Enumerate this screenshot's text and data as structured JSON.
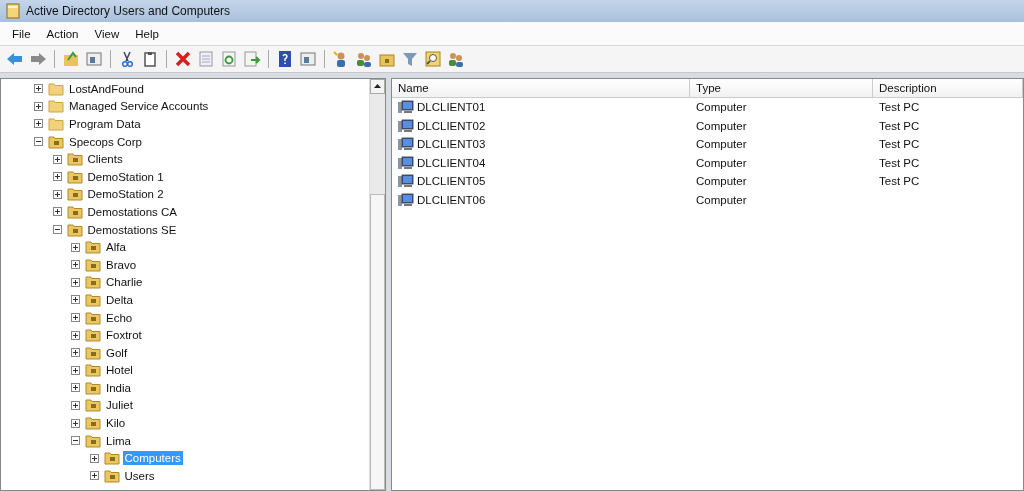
{
  "window": {
    "title": "Active Directory Users and Computers"
  },
  "menu": [
    "File",
    "Action",
    "View",
    "Help"
  ],
  "tree": [
    {
      "label": "LostAndFound",
      "kind": "container",
      "expanded": false,
      "selected": false
    },
    {
      "label": "Managed Service Accounts",
      "kind": "container",
      "expanded": false,
      "selected": false
    },
    {
      "label": "Program Data",
      "kind": "container",
      "expanded": false,
      "selected": false
    },
    {
      "label": "Specops Corp",
      "kind": "ou",
      "expanded": true,
      "selected": false,
      "children": [
        {
          "label": "Clients",
          "kind": "ou",
          "expanded": false,
          "selected": false
        },
        {
          "label": "DemoStation 1",
          "kind": "ou",
          "expanded": false,
          "selected": false
        },
        {
          "label": "DemoStation 2",
          "kind": "ou",
          "expanded": false,
          "selected": false
        },
        {
          "label": "Demostations CA",
          "kind": "ou",
          "expanded": false,
          "selected": false
        },
        {
          "label": "Demostations SE",
          "kind": "ou",
          "expanded": true,
          "selected": false,
          "children": [
            {
              "label": "Alfa",
              "kind": "ou",
              "expanded": false,
              "selected": false
            },
            {
              "label": "Bravo",
              "kind": "ou",
              "expanded": false,
              "selected": false
            },
            {
              "label": "Charlie",
              "kind": "ou",
              "expanded": false,
              "selected": false
            },
            {
              "label": "Delta",
              "kind": "ou",
              "expanded": false,
              "selected": false
            },
            {
              "label": "Echo",
              "kind": "ou",
              "expanded": false,
              "selected": false
            },
            {
              "label": "Foxtrot",
              "kind": "ou",
              "expanded": false,
              "selected": false
            },
            {
              "label": "Golf",
              "kind": "ou",
              "expanded": false,
              "selected": false
            },
            {
              "label": "Hotel",
              "kind": "ou",
              "expanded": false,
              "selected": false
            },
            {
              "label": "India",
              "kind": "ou",
              "expanded": false,
              "selected": false
            },
            {
              "label": "Juliet",
              "kind": "ou",
              "expanded": false,
              "selected": false
            },
            {
              "label": "Kilo",
              "kind": "ou",
              "expanded": false,
              "selected": false
            },
            {
              "label": "Lima",
              "kind": "ou",
              "expanded": true,
              "selected": false,
              "children": [
                {
                  "label": "Computers",
                  "kind": "ou",
                  "expanded": false,
                  "selected": true
                },
                {
                  "label": "Users",
                  "kind": "ou",
                  "expanded": false,
                  "selected": false
                }
              ]
            }
          ]
        }
      ]
    }
  ],
  "list": {
    "columns": [
      "Name",
      "Type",
      "Description"
    ],
    "rows": [
      {
        "name": "DLCLIENT01",
        "type": "Computer",
        "description": "Test PC"
      },
      {
        "name": "DLCLIENT02",
        "type": "Computer",
        "description": "Test PC"
      },
      {
        "name": "DLCLIENT03",
        "type": "Computer",
        "description": "Test PC"
      },
      {
        "name": "DLCLIENT04",
        "type": "Computer",
        "description": "Test PC"
      },
      {
        "name": "DLCLIENT05",
        "type": "Computer",
        "description": "Test PC"
      },
      {
        "name": "DLCLIENT06",
        "type": "Computer"
      }
    ]
  }
}
